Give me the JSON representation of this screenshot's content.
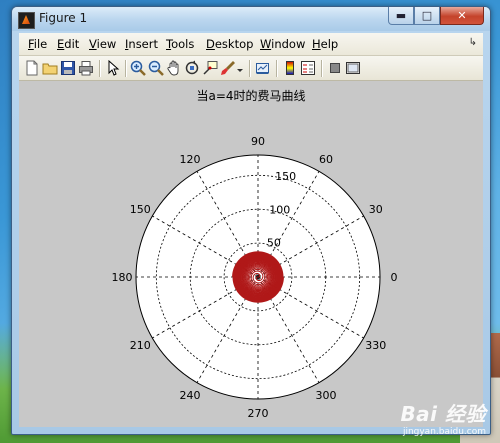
{
  "window": {
    "title": "Figure 1"
  },
  "menu": [
    {
      "name": "file",
      "u": "F",
      "rest": "ile"
    },
    {
      "name": "edit",
      "u": "E",
      "rest": "dit"
    },
    {
      "name": "view",
      "u": "V",
      "rest": "iew"
    },
    {
      "name": "insert",
      "u": "I",
      "rest": "nsert"
    },
    {
      "name": "tools",
      "u": "T",
      "rest": "ools"
    },
    {
      "name": "desktop",
      "u": "D",
      "rest": "esktop"
    },
    {
      "name": "window",
      "u": "W",
      "rest": "indow"
    },
    {
      "name": "help",
      "u": "H",
      "rest": "elp"
    }
  ],
  "toolbar": [
    "new-figure",
    "open-file",
    "save",
    "print",
    "edit-plot-arrow",
    "zoom-in",
    "zoom-out",
    "pan",
    "rotate-3d",
    "data-cursor",
    "brush",
    "link-plot",
    "insert-colorbar",
    "insert-legend",
    "hide-plot-tools",
    "show-plot-tools"
  ],
  "plot": {
    "title": "当a=4时的费马曲线",
    "angle_labels": [
      "0",
      "30",
      "60",
      "90",
      "120",
      "150",
      "180",
      "210",
      "240",
      "270",
      "300",
      "330"
    ],
    "radial_labels": [
      "50",
      "100",
      "150"
    ],
    "r_max": 180,
    "curve": {
      "type": "fermat-spiral",
      "a": 4,
      "equation": "r = a*sqrt(theta)",
      "color": "#b01818"
    }
  },
  "watermark": {
    "logo": "Bai 经验",
    "url": "jingyan.baidu.com"
  },
  "colors": {
    "figure_bg": "#c8c8c8",
    "axes_bg": "#ffffff",
    "curve": "#b01818"
  }
}
